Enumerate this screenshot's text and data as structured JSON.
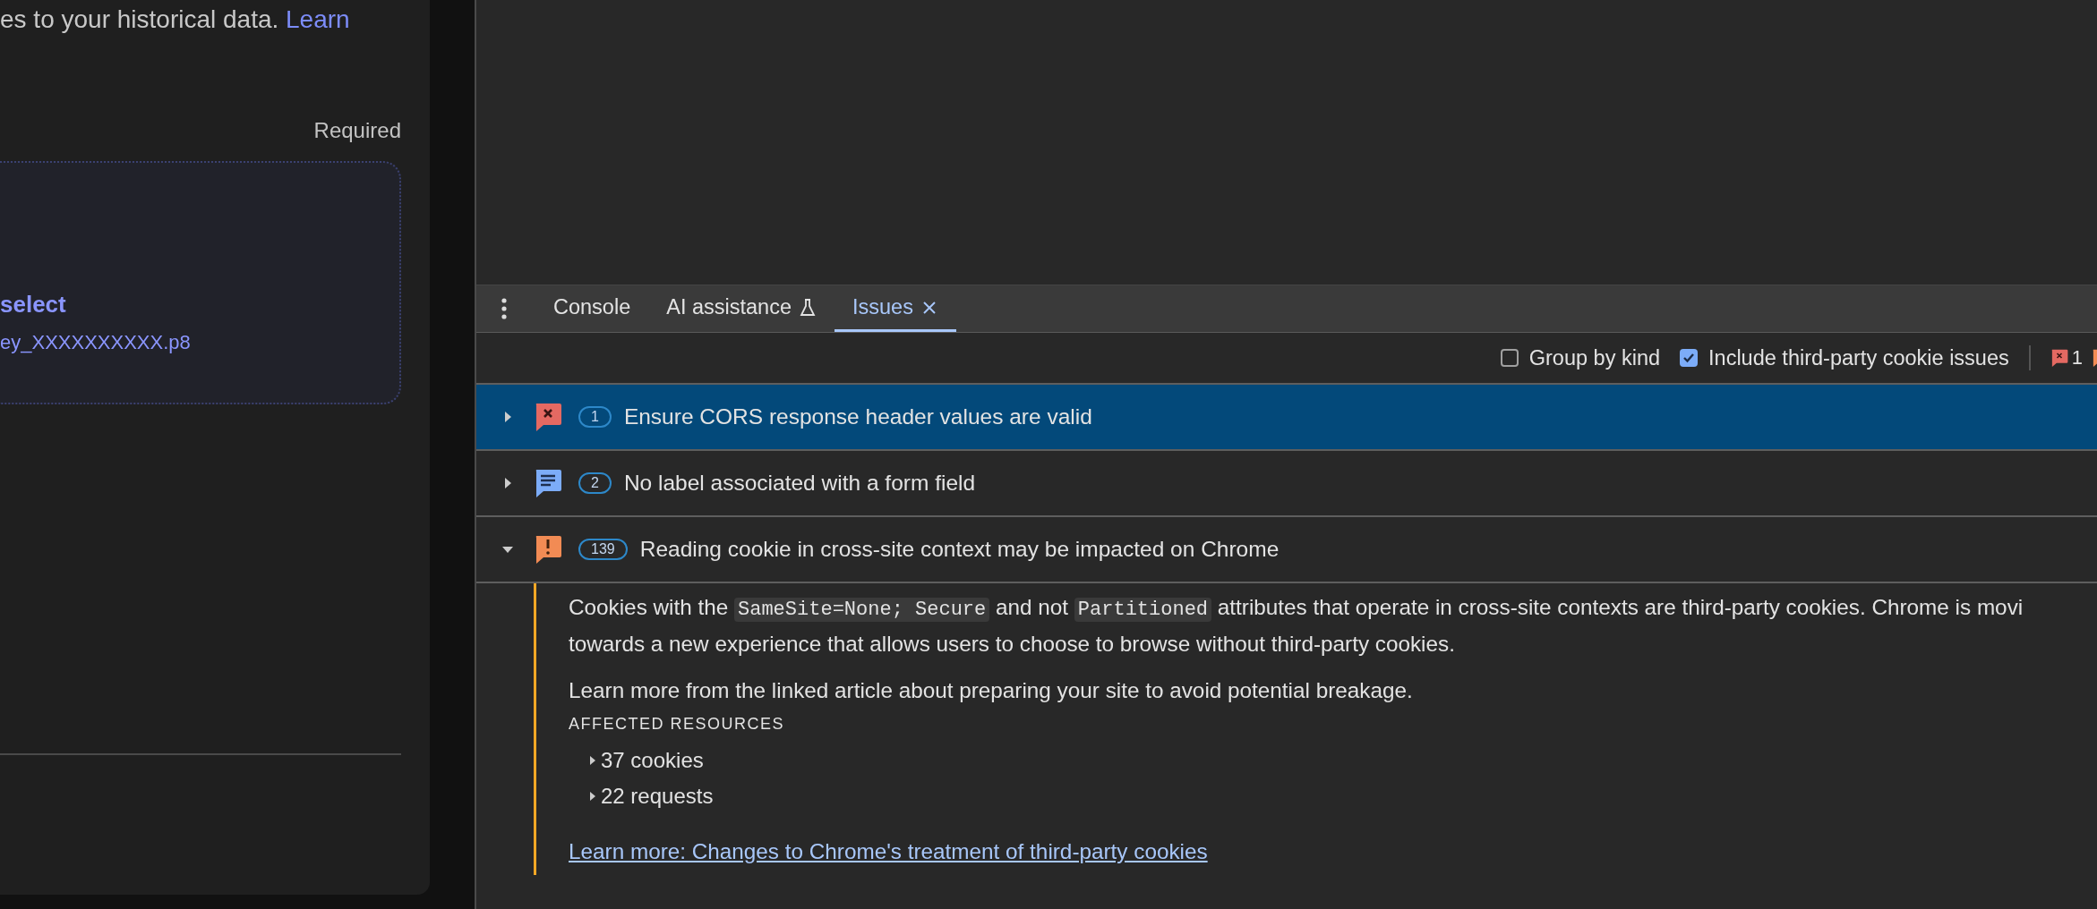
{
  "left_panel": {
    "description": {
      "text": "es to your historical data. ",
      "link": "Learn"
    },
    "required_label": "Required",
    "upload": {
      "action": "select",
      "filename": "ey_XXXXXXXXXX.p8"
    }
  },
  "devtools": {
    "tabs": [
      {
        "label": "Console",
        "selected": false
      },
      {
        "label": "AI assistance",
        "selected": false,
        "kind": "experimental"
      },
      {
        "label": "Issues",
        "selected": true,
        "kind": "closable"
      }
    ],
    "toolbar": {
      "checkboxes": [
        {
          "label": "Group by kind",
          "checked": false
        },
        {
          "label": "Include third-party cookie issues",
          "checked": true
        }
      ],
      "counts": [
        {
          "kind": "error",
          "count": "1"
        },
        {
          "kind": "warning"
        }
      ]
    },
    "issues": [
      {
        "kind": "error",
        "count": "1",
        "title": "Ensure CORS response header values are valid",
        "selected": true,
        "expanded": false
      },
      {
        "kind": "info",
        "count": "2",
        "title": "No label associated with a form field",
        "selected": false,
        "expanded": false
      },
      {
        "kind": "warning",
        "count": "139",
        "title": "Reading cookie in cross-site context may be impacted on Chrome",
        "selected": false,
        "expanded": true,
        "details": {
          "paragraphs": [
            [
              [
                {
                  "kind": "text",
                  "text": "Cookies with the "
                },
                {
                  "kind": "code",
                  "text": "SameSite=None; Secure"
                },
                {
                  "kind": "text",
                  "text": " and not "
                },
                {
                  "kind": "code",
                  "text": "Partitioned"
                },
                {
                  "kind": "text",
                  "text": " attributes that operate in cross-site contexts are third-party cookies. Chrome is movi"
                }
              ],
              [
                {
                  "kind": "text",
                  "text": "towards a new experience that allows users to choose to browse without third-party cookies."
                }
              ]
            ],
            [
              [
                {
                  "kind": "text",
                  "text": "Learn more from the linked article about preparing your site to avoid potential breakage."
                }
              ]
            ]
          ],
          "affected_heading": "AFFECTED RESOURCES",
          "resources": [
            {
              "label": "37 cookies",
              "expanded": false
            },
            {
              "label": "22 requests",
              "expanded": false
            }
          ],
          "link": "Learn more: Changes to Chrome's treatment of third-party cookies"
        }
      }
    ]
  }
}
